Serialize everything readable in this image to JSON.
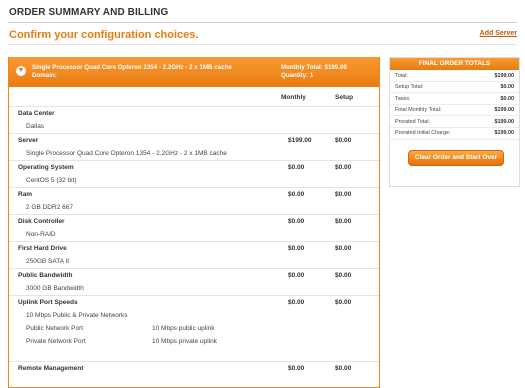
{
  "page": {
    "title": "ORDER SUMMARY AND BILLING",
    "subtitle": "Confirm your configuration choices.",
    "add_server": "Add Server"
  },
  "product": {
    "name": "Single Processor Quad Core Opteron 1354 - 2.2GHz - 2 x 1MB cache",
    "domain": "Domain:",
    "monthly_total": "Monthly Total: $199.00",
    "quantity": "Quantity: 1"
  },
  "columns": {
    "monthly": "Monthly",
    "setup": "Setup"
  },
  "rows": [
    {
      "type": "head",
      "label": "Data Center",
      "monthly": "",
      "setup": ""
    },
    {
      "type": "detail",
      "label": "Dallas"
    },
    {
      "type": "head",
      "label": "Server",
      "monthly": "$199.00",
      "setup": "$0.00"
    },
    {
      "type": "detail",
      "label": "Single Processor Quad Core Opteron 1354 - 2.2GHz - 2 x 1MB cache"
    },
    {
      "type": "head",
      "label": "Operating System",
      "monthly": "$0.00",
      "setup": "$0.00"
    },
    {
      "type": "detail",
      "label": "CentOS 5 (32 bit)"
    },
    {
      "type": "head",
      "label": "Ram",
      "monthly": "$0.00",
      "setup": "$0.00"
    },
    {
      "type": "detail",
      "label": "2 GB DDR2 667"
    },
    {
      "type": "head",
      "label": "Disk Controller",
      "monthly": "$0.00",
      "setup": "$0.00"
    },
    {
      "type": "detail",
      "label": "Non-RAID"
    },
    {
      "type": "head",
      "label": "First Hard Drive",
      "monthly": "$0.00",
      "setup": "$0.00"
    },
    {
      "type": "detail",
      "label": "250GB SATA II"
    },
    {
      "type": "head",
      "label": "Public Bandwidth",
      "monthly": "$0.00",
      "setup": "$0.00"
    },
    {
      "type": "detail",
      "label": "3000 GB Bandwidth"
    },
    {
      "type": "head",
      "label": "Uplink Port Speeds",
      "monthly": "$0.00",
      "setup": "$0.00"
    },
    {
      "type": "detail",
      "label": "10 Mbps Public & Private Networks"
    },
    {
      "type": "detail",
      "label": "Public Network Port",
      "extra": "10 Mbps public uplink"
    },
    {
      "type": "detail",
      "label": "Private Network Port",
      "extra": "10 Mbps private uplink"
    },
    {
      "type": "spacer",
      "label": ""
    },
    {
      "type": "head",
      "label": "Remote Management",
      "monthly": "$0.00",
      "setup": "$0.00"
    }
  ],
  "totals": {
    "title": "FINAL ORDER TOTALS",
    "items": [
      {
        "label": "Total:",
        "value": "$199.00"
      },
      {
        "label": "Setup Total:",
        "value": "$0.00"
      },
      {
        "label": "Taxes:",
        "value": "$0.00"
      },
      {
        "label": "Final Monthly Total:",
        "value": "$199.00"
      },
      {
        "label": "Prorated Total:",
        "value": "$199.00"
      },
      {
        "label": "Prorated Initial Charge:",
        "value": "$199.00"
      }
    ],
    "clear_button": "Clear Order and Start Over"
  }
}
